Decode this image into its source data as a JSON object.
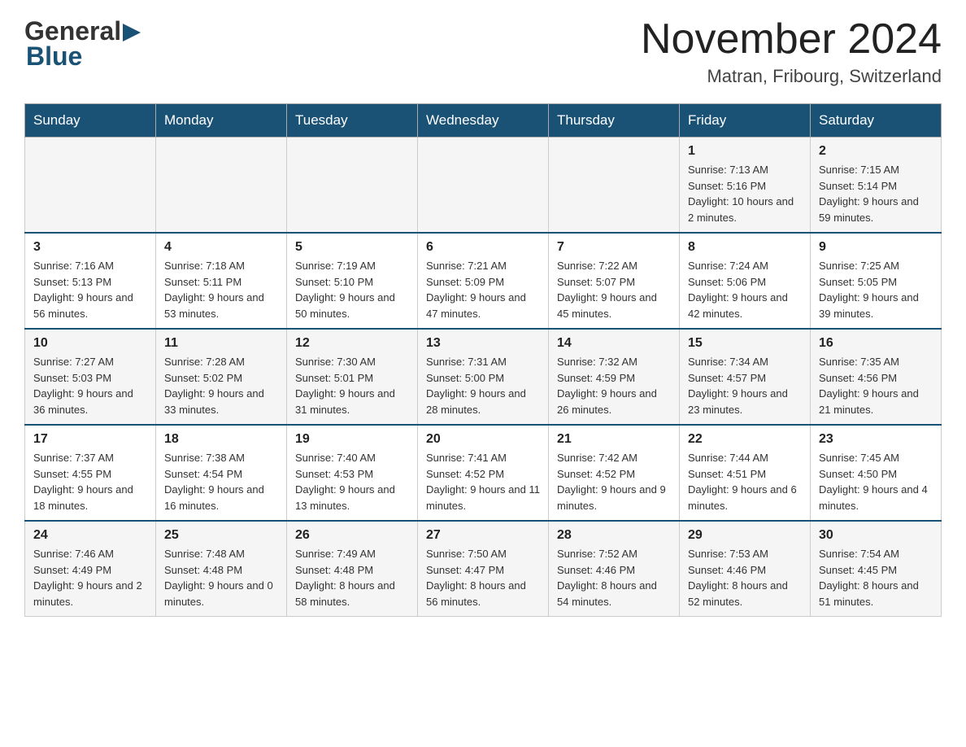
{
  "header": {
    "logo": {
      "general": "General",
      "blue": "Blue",
      "triangle": "▶"
    },
    "title": "November 2024",
    "location": "Matran, Fribourg, Switzerland"
  },
  "weekdays": [
    "Sunday",
    "Monday",
    "Tuesday",
    "Wednesday",
    "Thursday",
    "Friday",
    "Saturday"
  ],
  "weeks": [
    [
      {
        "day": "",
        "info": ""
      },
      {
        "day": "",
        "info": ""
      },
      {
        "day": "",
        "info": ""
      },
      {
        "day": "",
        "info": ""
      },
      {
        "day": "",
        "info": ""
      },
      {
        "day": "1",
        "info": "Sunrise: 7:13 AM\nSunset: 5:16 PM\nDaylight: 10 hours and 2 minutes."
      },
      {
        "day": "2",
        "info": "Sunrise: 7:15 AM\nSunset: 5:14 PM\nDaylight: 9 hours and 59 minutes."
      }
    ],
    [
      {
        "day": "3",
        "info": "Sunrise: 7:16 AM\nSunset: 5:13 PM\nDaylight: 9 hours and 56 minutes."
      },
      {
        "day": "4",
        "info": "Sunrise: 7:18 AM\nSunset: 5:11 PM\nDaylight: 9 hours and 53 minutes."
      },
      {
        "day": "5",
        "info": "Sunrise: 7:19 AM\nSunset: 5:10 PM\nDaylight: 9 hours and 50 minutes."
      },
      {
        "day": "6",
        "info": "Sunrise: 7:21 AM\nSunset: 5:09 PM\nDaylight: 9 hours and 47 minutes."
      },
      {
        "day": "7",
        "info": "Sunrise: 7:22 AM\nSunset: 5:07 PM\nDaylight: 9 hours and 45 minutes."
      },
      {
        "day": "8",
        "info": "Sunrise: 7:24 AM\nSunset: 5:06 PM\nDaylight: 9 hours and 42 minutes."
      },
      {
        "day": "9",
        "info": "Sunrise: 7:25 AM\nSunset: 5:05 PM\nDaylight: 9 hours and 39 minutes."
      }
    ],
    [
      {
        "day": "10",
        "info": "Sunrise: 7:27 AM\nSunset: 5:03 PM\nDaylight: 9 hours and 36 minutes."
      },
      {
        "day": "11",
        "info": "Sunrise: 7:28 AM\nSunset: 5:02 PM\nDaylight: 9 hours and 33 minutes."
      },
      {
        "day": "12",
        "info": "Sunrise: 7:30 AM\nSunset: 5:01 PM\nDaylight: 9 hours and 31 minutes."
      },
      {
        "day": "13",
        "info": "Sunrise: 7:31 AM\nSunset: 5:00 PM\nDaylight: 9 hours and 28 minutes."
      },
      {
        "day": "14",
        "info": "Sunrise: 7:32 AM\nSunset: 4:59 PM\nDaylight: 9 hours and 26 minutes."
      },
      {
        "day": "15",
        "info": "Sunrise: 7:34 AM\nSunset: 4:57 PM\nDaylight: 9 hours and 23 minutes."
      },
      {
        "day": "16",
        "info": "Sunrise: 7:35 AM\nSunset: 4:56 PM\nDaylight: 9 hours and 21 minutes."
      }
    ],
    [
      {
        "day": "17",
        "info": "Sunrise: 7:37 AM\nSunset: 4:55 PM\nDaylight: 9 hours and 18 minutes."
      },
      {
        "day": "18",
        "info": "Sunrise: 7:38 AM\nSunset: 4:54 PM\nDaylight: 9 hours and 16 minutes."
      },
      {
        "day": "19",
        "info": "Sunrise: 7:40 AM\nSunset: 4:53 PM\nDaylight: 9 hours and 13 minutes."
      },
      {
        "day": "20",
        "info": "Sunrise: 7:41 AM\nSunset: 4:52 PM\nDaylight: 9 hours and 11 minutes."
      },
      {
        "day": "21",
        "info": "Sunrise: 7:42 AM\nSunset: 4:52 PM\nDaylight: 9 hours and 9 minutes."
      },
      {
        "day": "22",
        "info": "Sunrise: 7:44 AM\nSunset: 4:51 PM\nDaylight: 9 hours and 6 minutes."
      },
      {
        "day": "23",
        "info": "Sunrise: 7:45 AM\nSunset: 4:50 PM\nDaylight: 9 hours and 4 minutes."
      }
    ],
    [
      {
        "day": "24",
        "info": "Sunrise: 7:46 AM\nSunset: 4:49 PM\nDaylight: 9 hours and 2 minutes."
      },
      {
        "day": "25",
        "info": "Sunrise: 7:48 AM\nSunset: 4:48 PM\nDaylight: 9 hours and 0 minutes."
      },
      {
        "day": "26",
        "info": "Sunrise: 7:49 AM\nSunset: 4:48 PM\nDaylight: 8 hours and 58 minutes."
      },
      {
        "day": "27",
        "info": "Sunrise: 7:50 AM\nSunset: 4:47 PM\nDaylight: 8 hours and 56 minutes."
      },
      {
        "day": "28",
        "info": "Sunrise: 7:52 AM\nSunset: 4:46 PM\nDaylight: 8 hours and 54 minutes."
      },
      {
        "day": "29",
        "info": "Sunrise: 7:53 AM\nSunset: 4:46 PM\nDaylight: 8 hours and 52 minutes."
      },
      {
        "day": "30",
        "info": "Sunrise: 7:54 AM\nSunset: 4:45 PM\nDaylight: 8 hours and 51 minutes."
      }
    ]
  ]
}
